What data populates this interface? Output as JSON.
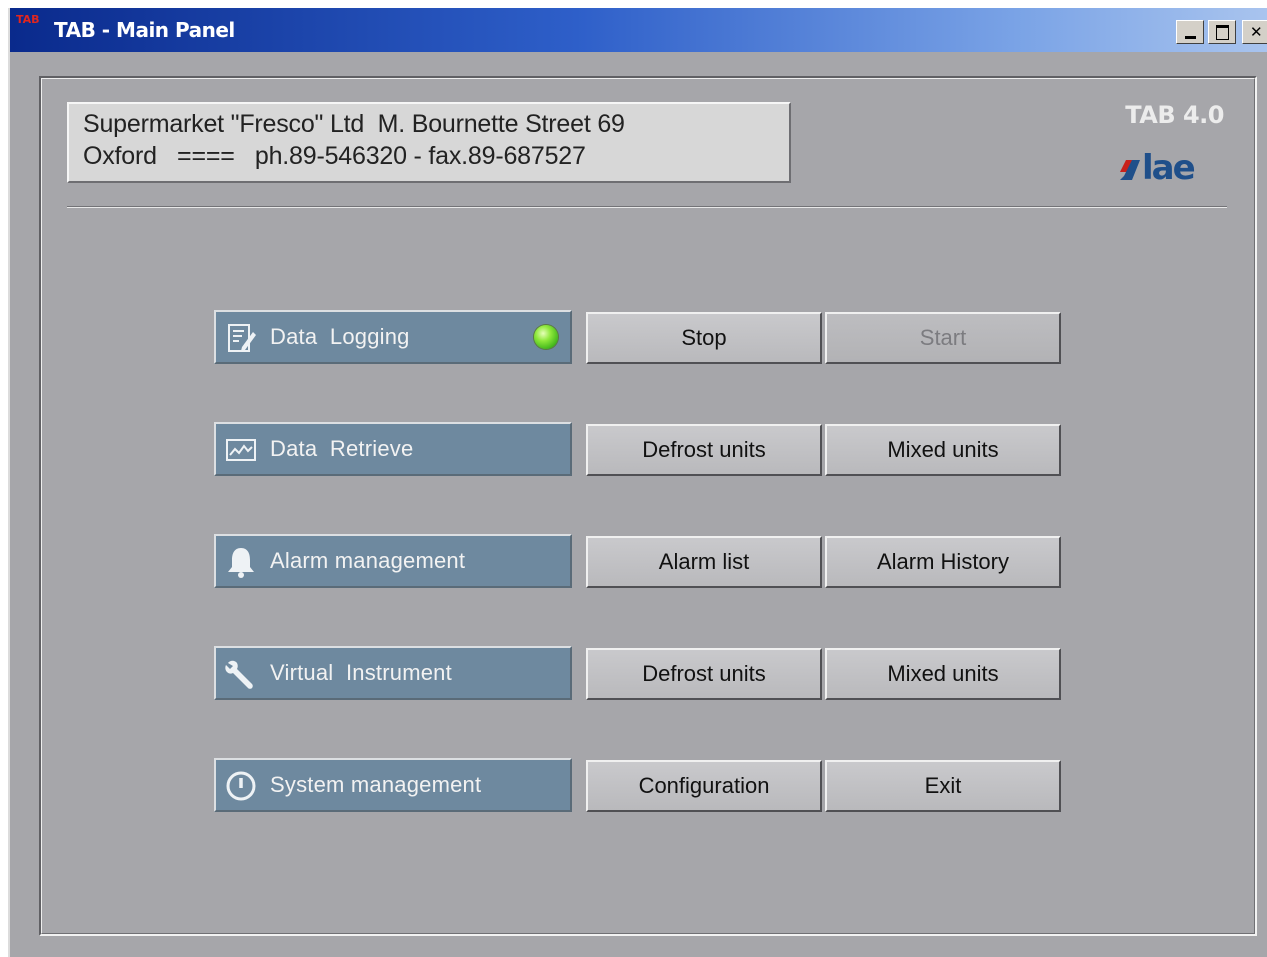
{
  "window": {
    "icon_text": "TAB",
    "title": "TAB - Main Panel",
    "controls": [
      "minimize",
      "maximize",
      "close"
    ]
  },
  "header": {
    "address_line1": "Supermarket \"Fresco\" Ltd  M. Bournette Street 69",
    "address_line2": "Oxford   ====   ph.89-546320 - fax.89-687527",
    "version": "TAB 4.0",
    "logo_text": "lae",
    "logo_color": "#1f4f8a",
    "logo_accent": "#c8211b"
  },
  "rows": [
    {
      "label": "Data  Logging",
      "icon": "notepad-pencil-icon",
      "status_led": "green",
      "buttons": [
        {
          "label": "Stop",
          "enabled": true
        },
        {
          "label": "Start",
          "enabled": false
        }
      ]
    },
    {
      "label": "Data  Retrieve",
      "icon": "graph-window-icon",
      "buttons": [
        {
          "label": "Defrost units",
          "enabled": true
        },
        {
          "label": "Mixed units",
          "enabled": true
        }
      ]
    },
    {
      "label": "Alarm management",
      "icon": "bell-icon",
      "buttons": [
        {
          "label": "Alarm list",
          "enabled": true
        },
        {
          "label": "Alarm History",
          "enabled": true
        }
      ]
    },
    {
      "label": "Virtual  Instrument",
      "icon": "wrench-icon",
      "buttons": [
        {
          "label": "Defrost units",
          "enabled": true
        },
        {
          "label": "Mixed units",
          "enabled": true
        }
      ]
    },
    {
      "label": "System management",
      "icon": "power-icon",
      "buttons": [
        {
          "label": "Configuration",
          "enabled": true
        },
        {
          "label": "Exit",
          "enabled": true
        }
      ]
    }
  ],
  "colors": {
    "titlebar_start": "#0a2a8c",
    "titlebar_end": "#a9c4ee",
    "panel_bg": "#a6a6aa",
    "row_label_bg": "#6e899f",
    "led_on": "#3fb51a"
  }
}
